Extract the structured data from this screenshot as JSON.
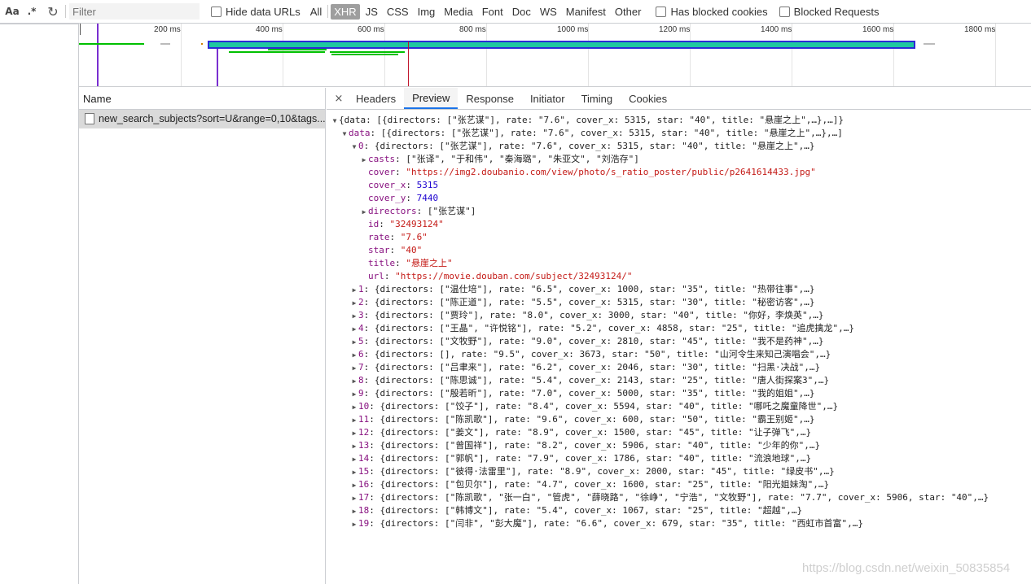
{
  "toolbar": {
    "case_sensitive": "Aa",
    "regex": ".*",
    "filter_placeholder": "Filter",
    "hide_data_urls": "Hide data URLs",
    "types": [
      "All",
      "XHR",
      "JS",
      "CSS",
      "Img",
      "Media",
      "Font",
      "Doc",
      "WS",
      "Manifest",
      "Other"
    ],
    "active_type": "XHR",
    "has_blocked_cookies": "Has blocked cookies",
    "blocked_requests": "Blocked Requests"
  },
  "overview": {
    "ticks": [
      "200 ms",
      "400 ms",
      "600 ms",
      "800 ms",
      "1000 ms",
      "1200 ms",
      "1400 ms",
      "1600 ms",
      "1800 ms"
    ]
  },
  "requests": {
    "header": "Name",
    "rows": [
      "new_search_subjects?sort=U&range=0,10&tags..."
    ]
  },
  "detail": {
    "close": "×",
    "tabs": [
      "Headers",
      "Preview",
      "Response",
      "Initiator",
      "Timing",
      "Cookies"
    ],
    "active_tab": "Preview"
  },
  "preview": {
    "root": "{data: [{directors: [\"张艺谋\"], rate: \"7.6\", cover_x: 5315, star: \"40\", title: \"悬崖之上\",…},…]}",
    "data_summary": "[{directors: [\"张艺谋\"], rate: \"7.6\", cover_x: 5315, star: \"40\", title: \"悬崖之上\",…},…]",
    "item0_summary": "{directors: [\"张艺谋\"], rate: \"7.6\", cover_x: 5315, star: \"40\", title: \"悬崖之上\",…}",
    "fields": [
      {
        "key": "casts",
        "value": "[\"张译\", \"于和伟\", \"秦海璐\", \"朱亚文\", \"刘浩存\"]",
        "type": "p",
        "expandable": true
      },
      {
        "key": "cover",
        "value": "\"https://img2.doubanio.com/view/photo/s_ratio_poster/public/p2641614433.jpg\"",
        "type": "s",
        "expandable": false
      },
      {
        "key": "cover_x",
        "value": "5315",
        "type": "n",
        "expandable": false
      },
      {
        "key": "cover_y",
        "value": "7440",
        "type": "n",
        "expandable": false
      },
      {
        "key": "directors",
        "value": "[\"张艺谋\"]",
        "type": "p",
        "expandable": true
      },
      {
        "key": "id",
        "value": "\"32493124\"",
        "type": "s",
        "expandable": false
      },
      {
        "key": "rate",
        "value": "\"7.6\"",
        "type": "s",
        "expandable": false
      },
      {
        "key": "star",
        "value": "\"40\"",
        "type": "s",
        "expandable": false
      },
      {
        "key": "title",
        "value": "\"悬崖之上\"",
        "type": "s",
        "expandable": false
      },
      {
        "key": "url",
        "value": "\"https://movie.douban.com/subject/32493124/\"",
        "type": "s",
        "expandable": false
      }
    ],
    "items": [
      {
        "key": "1",
        "summary": "{directors: [\"温仕培\"], rate: \"6.5\", cover_x: 1000, star: \"35\", title: \"热带往事\",…}"
      },
      {
        "key": "2",
        "summary": "{directors: [\"陈正道\"], rate: \"5.5\", cover_x: 5315, star: \"30\", title: \"秘密访客\",…}"
      },
      {
        "key": "3",
        "summary": "{directors: [\"贾玲\"], rate: \"8.0\", cover_x: 3000, star: \"40\", title: \"你好，李焕英\",…}"
      },
      {
        "key": "4",
        "summary": "{directors: [\"王晶\", \"许悦铭\"], rate: \"5.2\", cover_x: 4858, star: \"25\", title: \"追虎擒龙\",…}"
      },
      {
        "key": "5",
        "summary": "{directors: [\"文牧野\"], rate: \"9.0\", cover_x: 2810, star: \"45\", title: \"我不是药神\",…}"
      },
      {
        "key": "6",
        "summary": "{directors: [], rate: \"9.5\", cover_x: 3673, star: \"50\", title: \"山河令生来知己演唱会\",…}"
      },
      {
        "key": "7",
        "summary": "{directors: [\"吕聿来\"], rate: \"6.2\", cover_x: 2046, star: \"30\", title: \"扫黑·决战\",…}"
      },
      {
        "key": "8",
        "summary": "{directors: [\"陈思诚\"], rate: \"5.4\", cover_x: 2143, star: \"25\", title: \"唐人街探案3\",…}"
      },
      {
        "key": "9",
        "summary": "{directors: [\"殷若昕\"], rate: \"7.0\", cover_x: 5000, star: \"35\", title: \"我的姐姐\",…}"
      },
      {
        "key": "10",
        "summary": "{directors: [\"饺子\"], rate: \"8.4\", cover_x: 5594, star: \"40\", title: \"哪吒之魔童降世\",…}"
      },
      {
        "key": "11",
        "summary": "{directors: [\"陈凯歌\"], rate: \"9.6\", cover_x: 600, star: \"50\", title: \"霸王别姬\",…}"
      },
      {
        "key": "12",
        "summary": "{directors: [\"姜文\"], rate: \"8.9\", cover_x: 1500, star: \"45\", title: \"让子弹飞\",…}"
      },
      {
        "key": "13",
        "summary": "{directors: [\"曾国祥\"], rate: \"8.2\", cover_x: 5906, star: \"40\", title: \"少年的你\",…}"
      },
      {
        "key": "14",
        "summary": "{directors: [\"郭帆\"], rate: \"7.9\", cover_x: 1786, star: \"40\", title: \"流浪地球\",…}"
      },
      {
        "key": "15",
        "summary": "{directors: [\"彼得·法雷里\"], rate: \"8.9\", cover_x: 2000, star: \"45\", title: \"绿皮书\",…}"
      },
      {
        "key": "16",
        "summary": "{directors: [\"包贝尔\"], rate: \"4.7\", cover_x: 1600, star: \"25\", title: \"阳光姐妹淘\",…}"
      },
      {
        "key": "17",
        "summary": "{directors: [\"陈凯歌\", \"张一白\", \"管虎\", \"薛晓路\", \"徐峥\", \"宁浩\", \"文牧野\"], rate: \"7.7\", cover_x: 5906, star: \"40\",…}"
      },
      {
        "key": "18",
        "summary": "{directors: [\"韩博文\"], rate: \"5.4\", cover_x: 1067, star: \"25\", title: \"超越\",…}"
      },
      {
        "key": "19",
        "summary": "{directors: [\"闫非\", \"彭大魔\"], rate: \"6.6\", cover_x: 679, star: \"35\", title: \"西虹市首富\",…}"
      }
    ]
  },
  "watermark": "https://blog.csdn.net/weixin_50835854",
  "colors": {
    "key": "#881280",
    "string": "#c41a16",
    "number": "#1c00cf",
    "tab_accent": "#1a73e8",
    "bar_fill": "#1ec8a0",
    "bar_border": "#2b2bd6",
    "bar_green": "#00c000",
    "marker_purple": "#7a2fd0",
    "marker_red": "#c0142b"
  }
}
